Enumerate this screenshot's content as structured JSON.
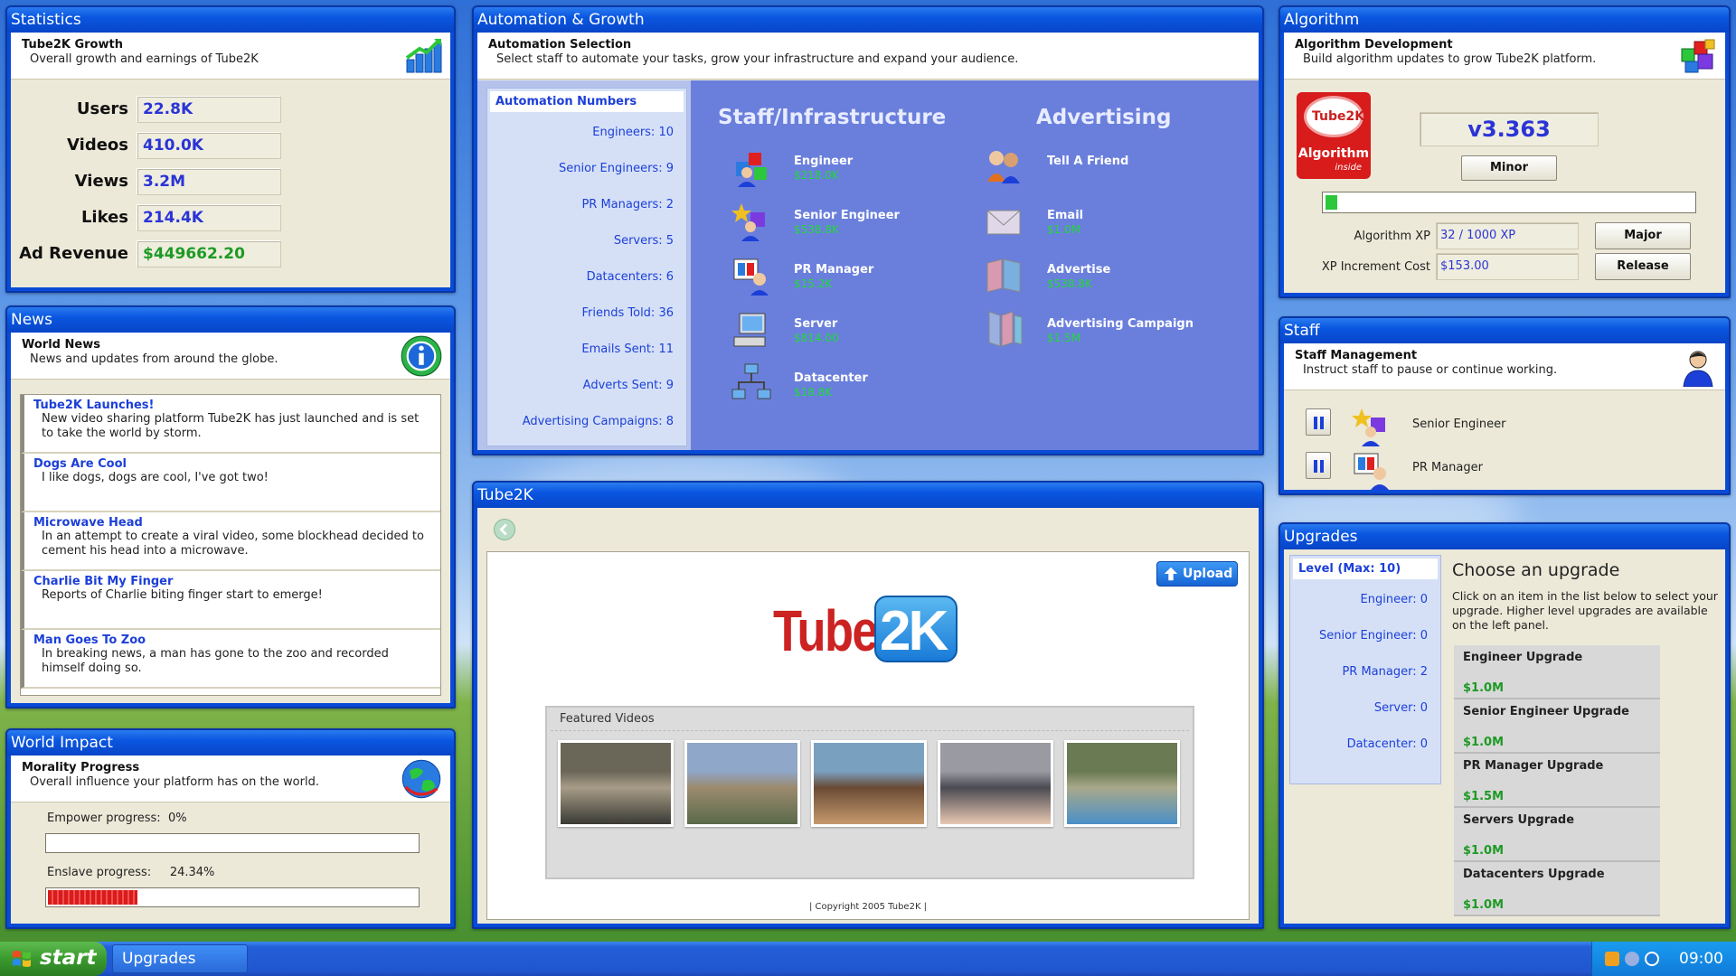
{
  "statistics": {
    "window_title": "Statistics",
    "header_title": "Tube2K Growth",
    "header_sub": "Overall growth and earnings of Tube2K",
    "rows": [
      {
        "label": "Users",
        "value": "22.8K"
      },
      {
        "label": "Videos",
        "value": "410.0K"
      },
      {
        "label": "Views",
        "value": "3.2M"
      },
      {
        "label": "Likes",
        "value": "214.4K"
      },
      {
        "label": "Ad Revenue",
        "value": "$449662.20"
      }
    ],
    "value_color": "#2a34d6",
    "money_color": "#1d9a25"
  },
  "news": {
    "window_title": "News",
    "header_title": "World News",
    "header_sub": "News and updates from around the globe.",
    "items": [
      {
        "headline": "Tube2K Launches!",
        "body": "New video sharing platform Tube2K has just launched and is set to take the world by storm."
      },
      {
        "headline": "Dogs Are Cool",
        "body": "I like dogs, dogs are cool, I've got two!"
      },
      {
        "headline": "Microwave Head",
        "body": "In an attempt to create a viral video, some blockhead decided to cement his head into a microwave."
      },
      {
        "headline": "Charlie Bit My Finger",
        "body": "Reports of Charlie biting finger start to emerge!"
      },
      {
        "headline": "Man Goes To Zoo",
        "body": "In breaking news, a man has gone to the zoo and recorded himself doing so."
      }
    ]
  },
  "world_impact": {
    "window_title": "World Impact",
    "header_title": "Morality Progress",
    "header_sub": "Overall influence your platform has on the world.",
    "empower_label": "Empower progress:",
    "empower_value": "0%",
    "empower_fraction": 0.0,
    "enslave_label": "Enslave progress:",
    "enslave_value": "24.34%",
    "enslave_fraction": 0.2434
  },
  "automation": {
    "window_title": "Automation & Growth",
    "header_title": "Automation Selection",
    "header_sub": "Select staff to automate your tasks, grow your infrastructure and expand your audience.",
    "numbers_title": "Automation Numbers",
    "numbers": [
      "Engineers: 10",
      "Senior Engineers: 9",
      "PR Managers: 2",
      "Servers: 5",
      "Datacenters: 6",
      "Friends Told: 36",
      "Emails Sent: 11",
      "Adverts Sent: 9",
      "Advertising Campaigns: 8"
    ],
    "staff_title": "Staff/Infrastructure",
    "advertising_title": "Advertising",
    "staff_items": [
      {
        "name": "Engineer",
        "cost": "$218.0K",
        "icon": "engineer-icon"
      },
      {
        "name": "Senior Engineer",
        "cost": "$538.8K",
        "icon": "senior-engineer-icon"
      },
      {
        "name": "PR Manager",
        "cost": "$15.2K",
        "icon": "pr-manager-icon"
      },
      {
        "name": "Server",
        "cost": "$814.00",
        "icon": "server-icon"
      },
      {
        "name": "Datacenter",
        "cost": "$18.8K",
        "icon": "datacenter-icon"
      }
    ],
    "advertising_items": [
      {
        "name": "Tell A Friend",
        "cost": "",
        "icon": "tell-friend-icon"
      },
      {
        "name": "Email",
        "cost": "$1.0M",
        "icon": "email-icon"
      },
      {
        "name": "Advertise",
        "cost": "$538.8K",
        "icon": "advertise-icon"
      },
      {
        "name": "Advertising Campaign",
        "cost": "$1.5M",
        "icon": "advertising-campaign-icon"
      }
    ],
    "cost_color": "#21d83a"
  },
  "tube2k": {
    "window_title": "Tube2K",
    "upload_label": "Upload",
    "logo_left": "Tube",
    "logo_right": "2K",
    "featured_title": "Featured Videos",
    "thumbnails": [
      {
        "name": "video-thumbnail-zoo",
        "colors": [
          "#6a6658",
          "#3a3a34",
          "#a89c88"
        ]
      },
      {
        "name": "video-thumbnail-hills",
        "colors": [
          "#8fa7c8",
          "#5a6a4a",
          "#9c8a6e"
        ]
      },
      {
        "name": "video-thumbnail-man",
        "colors": [
          "#7aa0c0",
          "#c69a6e",
          "#6a4a34"
        ]
      },
      {
        "name": "video-thumbnail-babies",
        "colors": [
          "#9a9aa2",
          "#e8c8b2",
          "#4a4a52"
        ]
      },
      {
        "name": "video-thumbnail-plants",
        "colors": [
          "#6a7a52",
          "#4a90c8",
          "#a8a88a"
        ]
      }
    ],
    "copyright": "| Copyright 2005 Tube2K |"
  },
  "algorithm": {
    "window_title": "Algorithm",
    "header_title": "Algorithm Development",
    "header_sub": "Build algorithm updates to grow Tube2K platform.",
    "badge_top": "Tube2K",
    "badge_bottom": "Algorithm",
    "badge_small": "inside",
    "version": "v3.363",
    "minor_label": "Minor",
    "xp_fraction": 0.032,
    "xp_label": "Algorithm XP",
    "xp_value": "32 / 1000 XP",
    "cost_label": "XP Increment Cost",
    "cost_value": "$153.00",
    "major_label": "Major",
    "release_label": "Release"
  },
  "staff": {
    "window_title": "Staff",
    "header_title": "Staff Management",
    "header_sub": "Instruct staff to pause or continue working.",
    "members": [
      {
        "name": "Senior Engineer",
        "icon": "senior-engineer-icon"
      },
      {
        "name": "PR Manager",
        "icon": "pr-manager-icon"
      }
    ]
  },
  "upgrades": {
    "window_title": "Upgrades",
    "level_title": "Level (Max: 10)",
    "levels": [
      "Engineer: 0",
      "Senior Engineer: 0",
      "PR Manager: 2",
      "Server: 0",
      "Datacenter: 0"
    ],
    "choose_title": "Choose an upgrade",
    "choose_desc": "Click on an item in the list below to select your upgrade. Higher level upgrades are available on the left panel.",
    "items": [
      {
        "name": "Engineer Upgrade",
        "cost": "$1.0M"
      },
      {
        "name": "Senior Engineer Upgrade",
        "cost": "$1.0M"
      },
      {
        "name": "PR Manager Upgrade",
        "cost": "$1.5M"
      },
      {
        "name": "Servers Upgrade",
        "cost": "$1.0M"
      },
      {
        "name": "Datacenters Upgrade",
        "cost": "$1.0M"
      }
    ]
  },
  "taskbar": {
    "start_label": "start",
    "task_label": "Upgrades",
    "clock": "09:00"
  }
}
